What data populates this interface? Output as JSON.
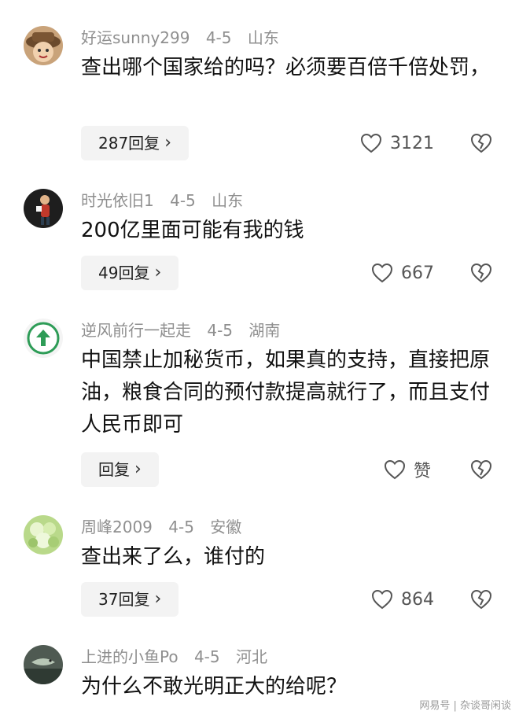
{
  "comments": [
    {
      "user": "好运sunny299",
      "date": "4-5",
      "location": "山东",
      "text": "查出哪个国家给的吗？必须要百倍千倍处罚，",
      "reply_label": "287回复",
      "likes": "3121"
    },
    {
      "user": "时光依旧1",
      "date": "4-5",
      "location": "山东",
      "text": "200亿里面可能有我的钱",
      "reply_label": "49回复",
      "likes": "667"
    },
    {
      "user": "逆风前行一起走",
      "date": "4-5",
      "location": "湖南",
      "text": "中国禁止加秘货币，如果真的支持，直接把原油，粮食合同的预付款提高就行了，而且支付人民币即可",
      "reply_label": "回复",
      "likes": "赞"
    },
    {
      "user": "周峰2009",
      "date": "4-5",
      "location": "安徽",
      "text": "查出来了么，谁付的",
      "reply_label": "37回复",
      "likes": "864"
    },
    {
      "user": "上进的小鱼Po",
      "date": "4-5",
      "location": "河北",
      "text": "为什么不敢光明正大的给呢？"
    }
  ],
  "icons": {
    "reply_chevron": "chevron-right-icon",
    "like": "heart-outline-icon",
    "dislike": "broken-heart-icon"
  },
  "watermark": "网易号 | 杂谈哥闲谈"
}
